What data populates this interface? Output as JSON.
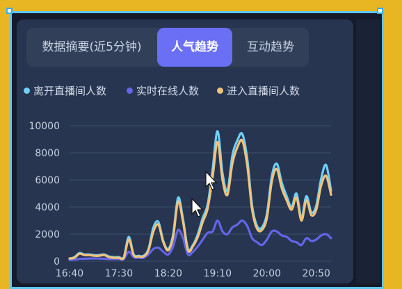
{
  "tabs": [
    {
      "label": "数据摘要(近5分钟)",
      "active": false
    },
    {
      "label": "人气趋势",
      "active": true
    },
    {
      "label": "互动趋势",
      "active": false
    }
  ],
  "colors": {
    "accent": "#6a6ff5",
    "series1": "#6fd0f6",
    "series2": "#6465e8",
    "series3": "#f1c27a"
  },
  "chart_data": {
    "type": "line",
    "x": [
      "16:40",
      "16:45",
      "16:50",
      "16:55",
      "17:00",
      "17:05",
      "17:10",
      "17:15",
      "17:20",
      "17:25",
      "17:30",
      "17:35",
      "17:40",
      "17:45",
      "17:50",
      "17:55",
      "18:00",
      "18:05",
      "18:10",
      "18:15",
      "18:20",
      "18:25",
      "18:30",
      "18:35",
      "18:40",
      "18:45",
      "18:50",
      "18:55",
      "19:00",
      "19:05",
      "19:10",
      "19:15",
      "19:20",
      "19:25",
      "19:30",
      "19:35",
      "19:40",
      "19:45",
      "19:50",
      "19:55",
      "20:00",
      "20:05",
      "20:10",
      "20:15",
      "20:20",
      "20:25",
      "20:30",
      "20:35",
      "20:40",
      "20:45",
      "20:50",
      "20:55",
      "21:00",
      "21:05"
    ],
    "xticks": [
      "16:40",
      "17:30",
      "18:20",
      "19:10",
      "20:00",
      "20:50"
    ],
    "ylim": [
      0,
      10000
    ],
    "yticks": [
      "0",
      "2000",
      "4000",
      "6000",
      "8000",
      "10000"
    ],
    "series": [
      {
        "name": "离开直播间人数",
        "color": "#6fd0f6",
        "values": [
          200,
          300,
          600,
          500,
          500,
          450,
          450,
          500,
          350,
          300,
          300,
          300,
          1800,
          500,
          400,
          400,
          900,
          2500,
          2900,
          1500,
          900,
          2000,
          4700,
          3100,
          900,
          1200,
          2000,
          3200,
          4200,
          6800,
          9600,
          6500,
          5200,
          7800,
          8900,
          9400,
          7600,
          4100,
          2600,
          2500,
          3500,
          6300,
          7200,
          5800,
          4800,
          4000,
          5000,
          3200,
          4800,
          3600,
          4100,
          6100,
          7100,
          5200
        ]
      },
      {
        "name": "实时在线人数",
        "color": "#6465e8",
        "values": [
          100,
          120,
          180,
          180,
          200,
          200,
          200,
          180,
          160,
          160,
          160,
          160,
          700,
          300,
          250,
          250,
          500,
          900,
          1000,
          700,
          500,
          1100,
          2300,
          1700,
          500,
          700,
          1100,
          1600,
          2100,
          2200,
          3000,
          2200,
          2000,
          2500,
          2700,
          3000,
          2600,
          1700,
          1400,
          1200,
          1600,
          2200,
          2200,
          1900,
          1800,
          1500,
          1400,
          1200,
          1700,
          1500,
          1600,
          1900,
          2000,
          1700
        ]
      },
      {
        "name": "进入直播间人数",
        "color": "#f1c27a",
        "values": [
          200,
          250,
          550,
          450,
          450,
          400,
          400,
          450,
          300,
          250,
          250,
          250,
          1600,
          450,
          350,
          350,
          800,
          2200,
          2700,
          1400,
          800,
          1800,
          4400,
          2900,
          800,
          1100,
          1800,
          2900,
          3900,
          6200,
          8800,
          6000,
          4900,
          7200,
          8400,
          8900,
          7100,
          3800,
          2400,
          2300,
          3200,
          5900,
          6800,
          5400,
          4500,
          3800,
          4700,
          3000,
          4500,
          3400,
          3800,
          5600,
          6300,
          4900
        ]
      }
    ]
  }
}
